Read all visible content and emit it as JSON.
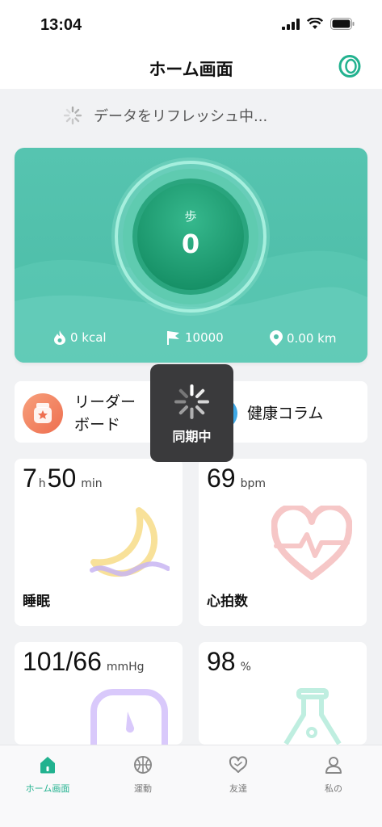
{
  "status_bar": {
    "time": "13:04"
  },
  "header": {
    "title": "ホーム画面"
  },
  "refresh": {
    "text": "データをリフレッシュ中..."
  },
  "activity": {
    "steps_label": "歩",
    "steps_value": "0",
    "calories": "0 kcal",
    "goal": "10000",
    "distance": "0.00 km"
  },
  "quick_links": {
    "leaderboard_line1": "リーダー",
    "leaderboard_line2": "ボード",
    "health_column": "健康コラム"
  },
  "toast": {
    "text": "同期中"
  },
  "tiles": {
    "sleep": {
      "hours": "7",
      "h_unit": "h",
      "minutes": "50",
      "min_unit": "min",
      "name": "睡眠"
    },
    "heart": {
      "value": "69",
      "unit": "bpm",
      "name": "心拍数"
    },
    "bp": {
      "value": "101/66",
      "unit": "mmHg"
    },
    "spo2": {
      "value": "98",
      "unit": "%"
    }
  },
  "tabs": [
    {
      "label": "ホーム画面",
      "icon": "home-icon",
      "active": true
    },
    {
      "label": "運動",
      "icon": "basketball-icon",
      "active": false
    },
    {
      "label": "友達",
      "icon": "heart-chat-icon",
      "active": false
    },
    {
      "label": "私の",
      "icon": "person-icon",
      "active": false
    }
  ],
  "colors": {
    "accent": "#22b28f",
    "card": "#4fbfa9",
    "toast": "#3a3a3c"
  }
}
